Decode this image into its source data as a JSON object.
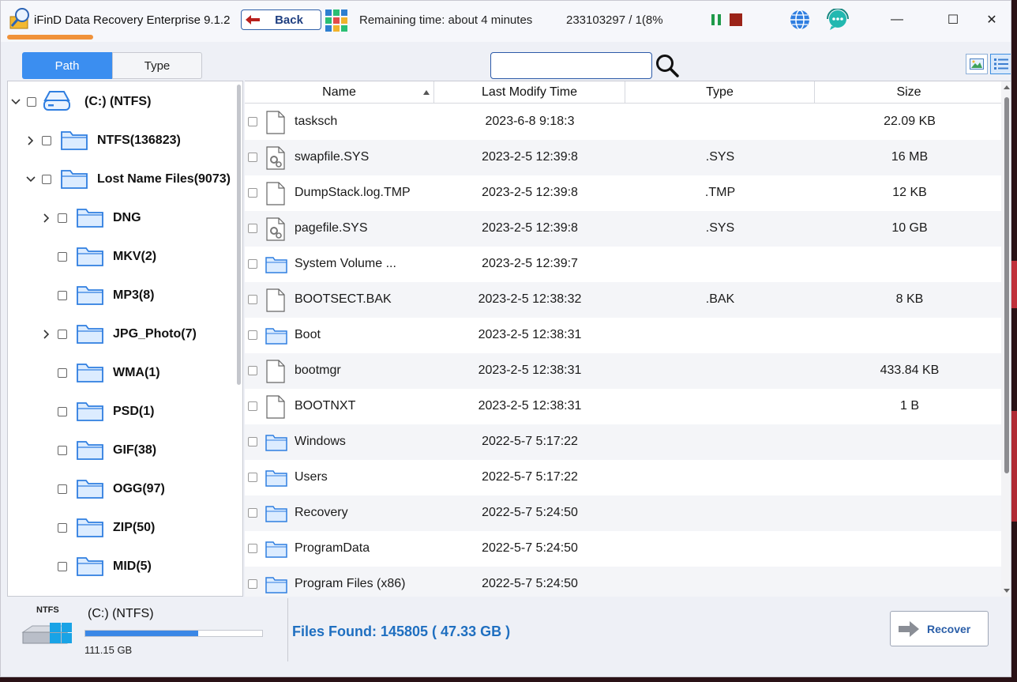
{
  "app": {
    "title": "iFinD Data Recovery Enterprise 9.1.2",
    "back_label": "Back",
    "remaining_time": "Remaining time: about  4  minutes",
    "scan_progress": "233103297 / 1(8%"
  },
  "window_controls": {
    "minimize": "—",
    "maximize": "☐",
    "close": "✕"
  },
  "tabs": {
    "path": "Path",
    "type": "Type",
    "active": "Path"
  },
  "search": {
    "value": "",
    "placeholder": ""
  },
  "tree": [
    {
      "label": "(C:) (NTFS)",
      "level": 0,
      "expanded": true,
      "icon": "drive-icon"
    },
    {
      "label": "NTFS(136823)",
      "level": 1,
      "expandable": true,
      "icon": "folder-icon"
    },
    {
      "label": "Lost Name Files(9073)",
      "level": 1,
      "expanded": true,
      "icon": "folder-icon"
    },
    {
      "label": "DNG",
      "level": 2,
      "expandable": true,
      "icon": "folder-icon"
    },
    {
      "label": "MKV(2)",
      "level": 2,
      "icon": "folder-icon"
    },
    {
      "label": "MP3(8)",
      "level": 2,
      "icon": "folder-icon"
    },
    {
      "label": "JPG_Photo(7)",
      "level": 2,
      "expandable": true,
      "icon": "folder-icon"
    },
    {
      "label": "WMA(1)",
      "level": 2,
      "icon": "folder-icon"
    },
    {
      "label": "PSD(1)",
      "level": 2,
      "icon": "folder-icon"
    },
    {
      "label": "GIF(38)",
      "level": 2,
      "icon": "folder-icon"
    },
    {
      "label": "OGG(97)",
      "level": 2,
      "icon": "folder-icon"
    },
    {
      "label": "ZIP(50)",
      "level": 2,
      "icon": "folder-icon"
    },
    {
      "label": "MID(5)",
      "level": 2,
      "icon": "folder-icon"
    }
  ],
  "table": {
    "columns": [
      "Name",
      "Last Modify Time",
      "Type",
      "Size"
    ],
    "rows": [
      {
        "name": "tasksch",
        "time": "2023-6-8 9:18:3",
        "type": "",
        "size": "22.09 KB",
        "icon": "file"
      },
      {
        "name": "swapfile.SYS",
        "time": "2023-2-5 12:39:8",
        "type": ".SYS",
        "size": "16 MB",
        "icon": "sysfile"
      },
      {
        "name": "DumpStack.log.TMP",
        "time": "2023-2-5 12:39:8",
        "type": ".TMP",
        "size": "12 KB",
        "icon": "file"
      },
      {
        "name": "pagefile.SYS",
        "time": "2023-2-5 12:39:8",
        "type": ".SYS",
        "size": "10 GB",
        "icon": "sysfile"
      },
      {
        "name": "System Volume ...",
        "time": "2023-2-5 12:39:7",
        "type": "",
        "size": "",
        "icon": "folder"
      },
      {
        "name": "BOOTSECT.BAK",
        "time": "2023-2-5 12:38:32",
        "type": ".BAK",
        "size": "8 KB",
        "icon": "file"
      },
      {
        "name": "Boot",
        "time": "2023-2-5 12:38:31",
        "type": "",
        "size": "",
        "icon": "folder"
      },
      {
        "name": "bootmgr",
        "time": "2023-2-5 12:38:31",
        "type": "",
        "size": "433.84 KB",
        "icon": "file"
      },
      {
        "name": "BOOTNXT",
        "time": "2023-2-5 12:38:31",
        "type": "",
        "size": "1 B",
        "icon": "file"
      },
      {
        "name": "Windows",
        "time": "2022-5-7 5:17:22",
        "type": "",
        "size": "",
        "icon": "folder"
      },
      {
        "name": "Users",
        "time": "2022-5-7 5:17:22",
        "type": "",
        "size": "",
        "icon": "folder"
      },
      {
        "name": "Recovery",
        "time": "2022-5-7 5:24:50",
        "type": "",
        "size": "",
        "icon": "folder"
      },
      {
        "name": "ProgramData",
        "time": "2022-5-7 5:24:50",
        "type": "",
        "size": "",
        "icon": "folder"
      },
      {
        "name": "Program Files (x86)",
        "time": "2022-5-7 5:24:50",
        "type": "",
        "size": "",
        "icon": "folder"
      }
    ]
  },
  "drive": {
    "fs": "NTFS",
    "name": "(C:) (NTFS)",
    "size": "111.15 GB",
    "used_fraction": 0.64
  },
  "files_found": "Files Found:  145805 ( 47.33 GB )",
  "recover_label": "Recover",
  "colors": {
    "accent": "#3b8ef0",
    "stop": "#9b2318",
    "pause": "#1f9a4a",
    "found_text": "#1f6fc0"
  }
}
